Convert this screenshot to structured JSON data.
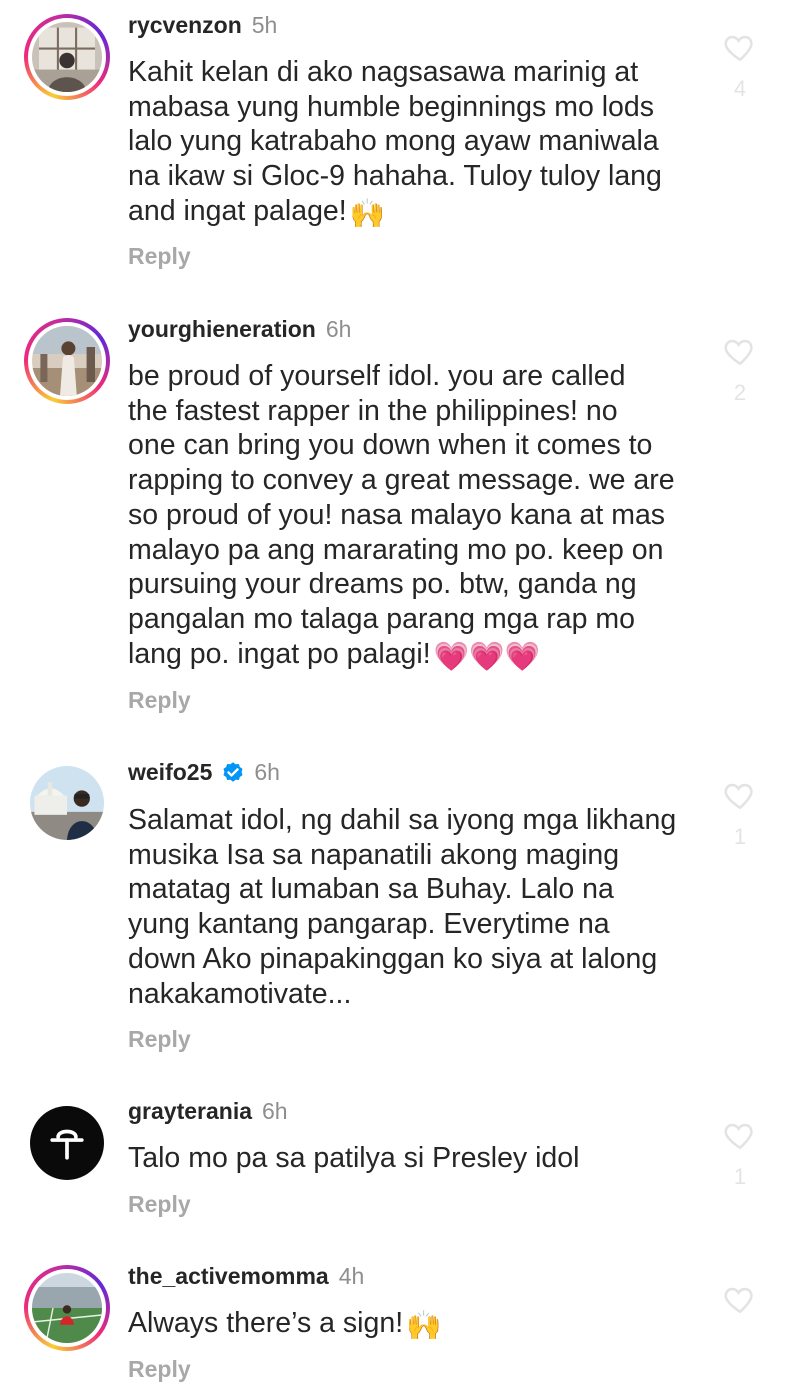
{
  "comments": [
    {
      "username": "rycvenzon",
      "time": "5h",
      "text": "Kahit kelan di ako nagsasawa marinig at\nmabasa yung humble beginnings mo lods\nlalo yung katrabaho mong ayaw maniwala\nna ikaw si Gloc-9 hahaha. Tuloy tuloy lang\nand ingat palage!",
      "emoji": "🙌",
      "reply_label": "Reply",
      "likes": "4",
      "avatar_icon": "avatar-window-silhouette"
    },
    {
      "username": "yourghieneration",
      "time": "6h",
      "text": "be proud of yourself idol. you are called\nthe fastest rapper in the philippines! no\none can bring you down when it comes to\nrapping to convey a great message. we are\nso proud of you! nasa malayo kana at mas\nmalayo pa ang mararating mo po. keep on\npursuing your dreams po. btw, ganda ng\npangalan mo talaga parang mga rap mo\nlang po. ingat po palagi!",
      "emoji": "💗💗💗",
      "reply_label": "Reply",
      "likes": "2",
      "avatar_icon": "avatar-person-outdoors"
    },
    {
      "username": "weifo25",
      "verified": true,
      "time": "6h",
      "text": "Salamat idol, ng dahil sa iyong mga likhang\nmusika Isa sa napanatili akong maging\nmatatag at lumaban sa Buhay. Lalo na\nyung kantang pangarap. Everytime na\ndown Ako pinapakinggan ko siya at lalong\nnakakamotivate...",
      "reply_label": "Reply",
      "likes": "1",
      "avatar_icon": "avatar-person-landmark"
    },
    {
      "username": "grayterania",
      "time": "6h",
      "text": "Talo mo pa sa patilya si Presley idol",
      "reply_label": "Reply",
      "likes": "1",
      "avatar_icon": "avatar-logo-black"
    },
    {
      "username": "the_activemomma",
      "time": "4h",
      "text": "Always there’s a sign!",
      "emoji": "🙌",
      "reply_label": "Reply",
      "avatar_icon": "avatar-person-field"
    }
  ],
  "colors": {
    "text": "#262626",
    "muted": "#8e8e8e",
    "reply": "#a8a8a8",
    "verified": "#0095f6",
    "story_ring": "#ee2a7b"
  }
}
